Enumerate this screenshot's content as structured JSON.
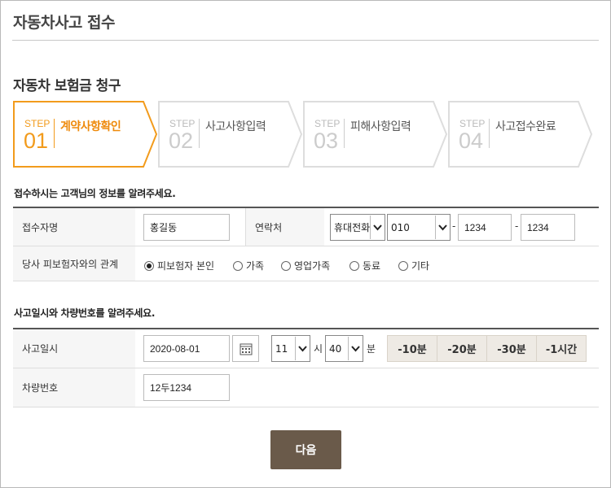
{
  "page": {
    "title": "자동차사고 접수"
  },
  "section": {
    "title": "자동차 보험금 청구"
  },
  "steps": [
    {
      "label": "STEP",
      "number": "01",
      "name": "계약사항확인",
      "active": true
    },
    {
      "label": "STEP",
      "number": "02",
      "name": "사고사항입력",
      "active": false
    },
    {
      "label": "STEP",
      "number": "03",
      "name": "피해사항입력",
      "active": false
    },
    {
      "label": "STEP",
      "number": "04",
      "name": "사고접수완료",
      "active": false
    }
  ],
  "customer": {
    "heading": "접수하시는 고객님의 정보를 알려주세요.",
    "name_label": "접수자명",
    "name_value": "홍길동",
    "contact_label": "연락처",
    "phone_type": "휴대전화",
    "phone_prefix": "010",
    "phone_dash": "-",
    "phone_mid": "1234",
    "phone_last": "1234",
    "relation_label": "당사 피보험자와의 관계",
    "relation_options": [
      "피보험자 본인",
      "가족",
      "영업가족",
      "동료",
      "기타"
    ],
    "relation_selected": "피보험자 본인"
  },
  "accident": {
    "heading": "사고일시와 차량번호를 알려주세요.",
    "date_label": "사고일시",
    "date_value": "2020-08-01",
    "hour_value": "11",
    "hour_unit": "시",
    "minute_value": "40",
    "minute_unit": "분",
    "quick_buttons": [
      "-10분",
      "-20분",
      "-30분",
      "-1시간"
    ],
    "car_label": "차량번호",
    "car_value": "12두1234"
  },
  "actions": {
    "next_label": "다음"
  },
  "colors": {
    "accent": "#f29b1c",
    "button": "#6a5a4a",
    "quick_bg": "#eeeae4"
  },
  "icons": {
    "calendar": "calendar-icon",
    "select_arrow": "chevron-down-icon"
  }
}
